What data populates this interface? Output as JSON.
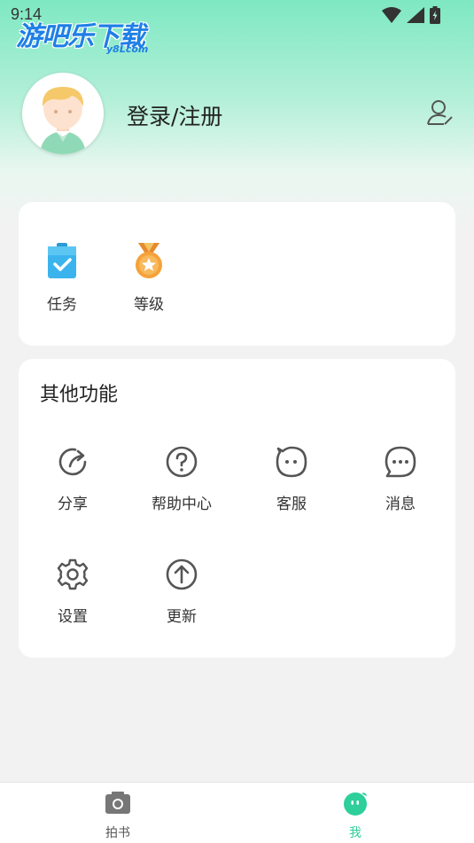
{
  "status_bar": {
    "time": "9:14"
  },
  "watermark": {
    "main": "游吧乐下载",
    "sub": "y8Lcom"
  },
  "header": {
    "login_label": "登录/注册"
  },
  "quick_actions": [
    {
      "label": "任务",
      "icon": "clipboard-check-icon"
    },
    {
      "label": "等级",
      "icon": "medal-icon"
    }
  ],
  "other_functions": {
    "title": "其他功能",
    "items": [
      {
        "label": "分享",
        "icon": "share-icon"
      },
      {
        "label": "帮助中心",
        "icon": "help-icon"
      },
      {
        "label": "客服",
        "icon": "customer-service-icon"
      },
      {
        "label": "消息",
        "icon": "message-icon"
      },
      {
        "label": "设置",
        "icon": "settings-icon"
      },
      {
        "label": "更新",
        "icon": "update-icon"
      }
    ]
  },
  "tabbar": {
    "tabs": [
      {
        "label": "拍书",
        "icon": "camera-icon",
        "active": false
      },
      {
        "label": "我",
        "icon": "me-icon",
        "active": true
      }
    ]
  },
  "colors": {
    "accent": "#2ecf9a",
    "header_gradient_top": "#7ee8c2",
    "background": "#f2f2f2",
    "icon_gray": "#555555",
    "task_blue": "#3bb4ee",
    "medal_orange": "#f5a23a",
    "watermark_blue": "#1f7fe6"
  }
}
